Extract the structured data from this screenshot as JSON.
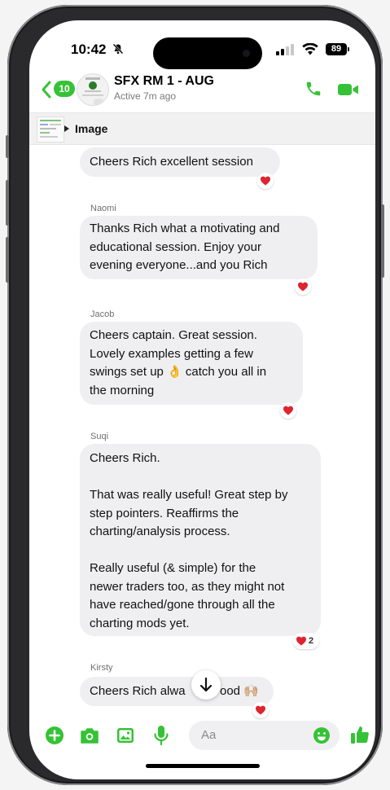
{
  "status_bar": {
    "time": "10:42",
    "battery": "89"
  },
  "header": {
    "back_count": "10",
    "title": "SFX RM 1 - AUG",
    "subtitle": "Active 7m ago"
  },
  "pinned": {
    "label": "Image"
  },
  "messages": [
    {
      "sender": "",
      "text": "Cheers Rich excellent session",
      "reaction": ""
    },
    {
      "sender": "Naomi",
      "text": "Thanks Rich what a motivating and\neducational session. Enjoy your\nevening everyone...and you Rich",
      "reaction": ""
    },
    {
      "sender": "Jacob",
      "text": "Cheers captain. Great session.\nLovely examples getting a few\nswings set up 👌 catch you all in\nthe morning",
      "reaction": ""
    },
    {
      "sender": "Suqi",
      "text": "Cheers Rich.\n\nThat was really useful! Great step by\nstep pointers. Reaffirms the\ncharting/analysis process.\n\nReally useful (& simple) for the\nnewer traders too, as they might not\nhave reached/gone through all the\ncharting mods yet.",
      "reaction": "2"
    },
    {
      "sender": "Kirsty",
      "text": "Cheers Rich alwa",
      "text_tail": "ood 🙌🏼",
      "reaction": ""
    }
  ],
  "composer": {
    "placeholder": "Aa"
  },
  "colors": {
    "accent": "#36c236",
    "bubble": "#efeff1",
    "heart": "#e0232e"
  }
}
